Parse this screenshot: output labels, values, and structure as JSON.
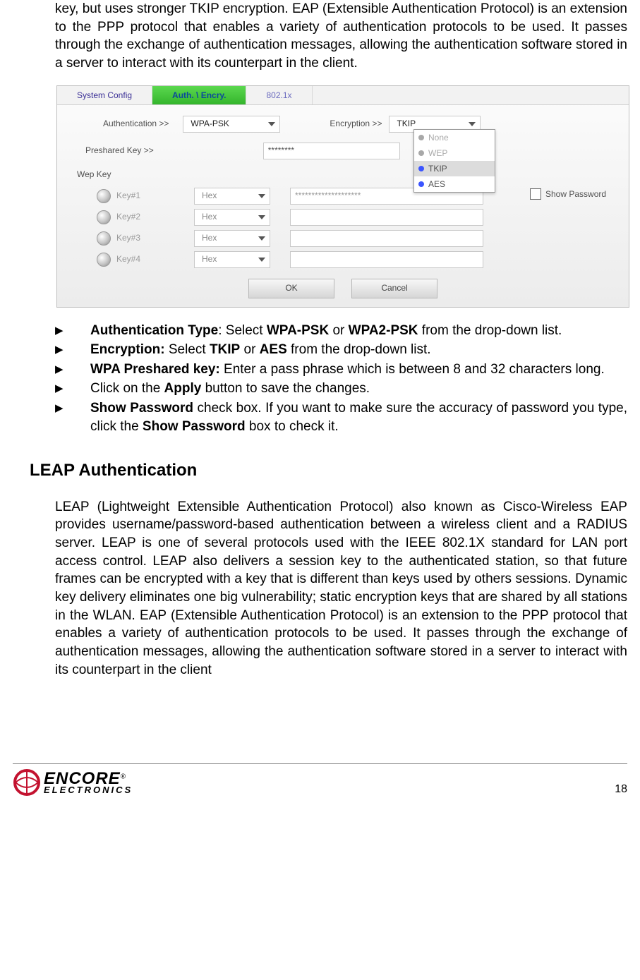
{
  "intro_paragraph": "key, but uses stronger TKIP encryption. EAP (Extensible Authentication Protocol) is an extension to the PPP protocol that enables a variety of authentication protocols to be used. It passes through the exchange of authentication messages, allowing the authentication software stored in a server to interact with its counterpart in the client.",
  "app": {
    "tabs": {
      "system": "System Config",
      "auth": "Auth. \\ Encry.",
      "dot1x": "802.1x"
    },
    "labels": {
      "authentication": "Authentication >>",
      "encryption": "Encryption >>",
      "preshared": "Preshared Key >>",
      "wepkey": "Wep Key",
      "show_password": "Show Password"
    },
    "auth_value": "WPA-PSK",
    "enc_value": "TKIP",
    "enc_options": [
      "None",
      "WEP",
      "TKIP",
      "AES"
    ],
    "preshared_value": "********",
    "keys": [
      {
        "label": "Key#1",
        "type": "Hex",
        "value": "********************"
      },
      {
        "label": "Key#2",
        "type": "Hex",
        "value": ""
      },
      {
        "label": "Key#3",
        "type": "Hex",
        "value": ""
      },
      {
        "label": "Key#4",
        "type": "Hex",
        "value": ""
      }
    ],
    "buttons": {
      "ok": "OK",
      "cancel": "Cancel"
    }
  },
  "bullets": [
    {
      "bold_prefix": "Authentication Type",
      "rest": ": Select ",
      "b2": "WPA-PSK",
      "mid": " or ",
      "b3": "WPA2-PSK",
      "tail": " from the drop-down list."
    },
    {
      "bold_prefix": "Encryption:",
      "rest": " Select ",
      "b2": "TKIP",
      "mid": " or ",
      "b3": "AES",
      "tail": " from the drop-down list."
    },
    {
      "bold_prefix": "WPA Preshared key:",
      "rest": " Enter a pass phrase which is between 8 and 32 characters long."
    },
    {
      "plain_pre": "Click on the ",
      "b2": "Apply",
      "tail": " button to save the changes."
    },
    {
      "bold_prefix": "Show Password",
      "rest": " check box. If you want to make sure the accuracy of password you type, click the ",
      "b2": "Show Password",
      "tail": " box to check it."
    }
  ],
  "section_heading": "LEAP Authentication",
  "leap_paragraph": "LEAP (Lightweight Extensible Authentication Protocol) also known as Cisco-Wireless EAP provides username/password-based authentication between a wireless client and a RADIUS server.  LEAP is one of several protocols used with the IEEE 802.1X standard for LAN port access control. LEAP also delivers a session key to the authenticated station, so that future frames can be encrypted with a key that is different than keys used by others sessions. Dynamic key delivery eliminates one big vulnerability; static encryption keys that are shared by all stations in the WLAN. EAP (Extensible Authentication Protocol) is an extension to the PPP protocol that enables a variety of authentication protocols to be used. It passes through the exchange of authentication messages, allowing the authentication software stored in a server to interact with its counterpart in the client",
  "footer": {
    "brand_top": "ENCORE",
    "brand_bottom": "ELECTRONICS",
    "page": "18"
  }
}
